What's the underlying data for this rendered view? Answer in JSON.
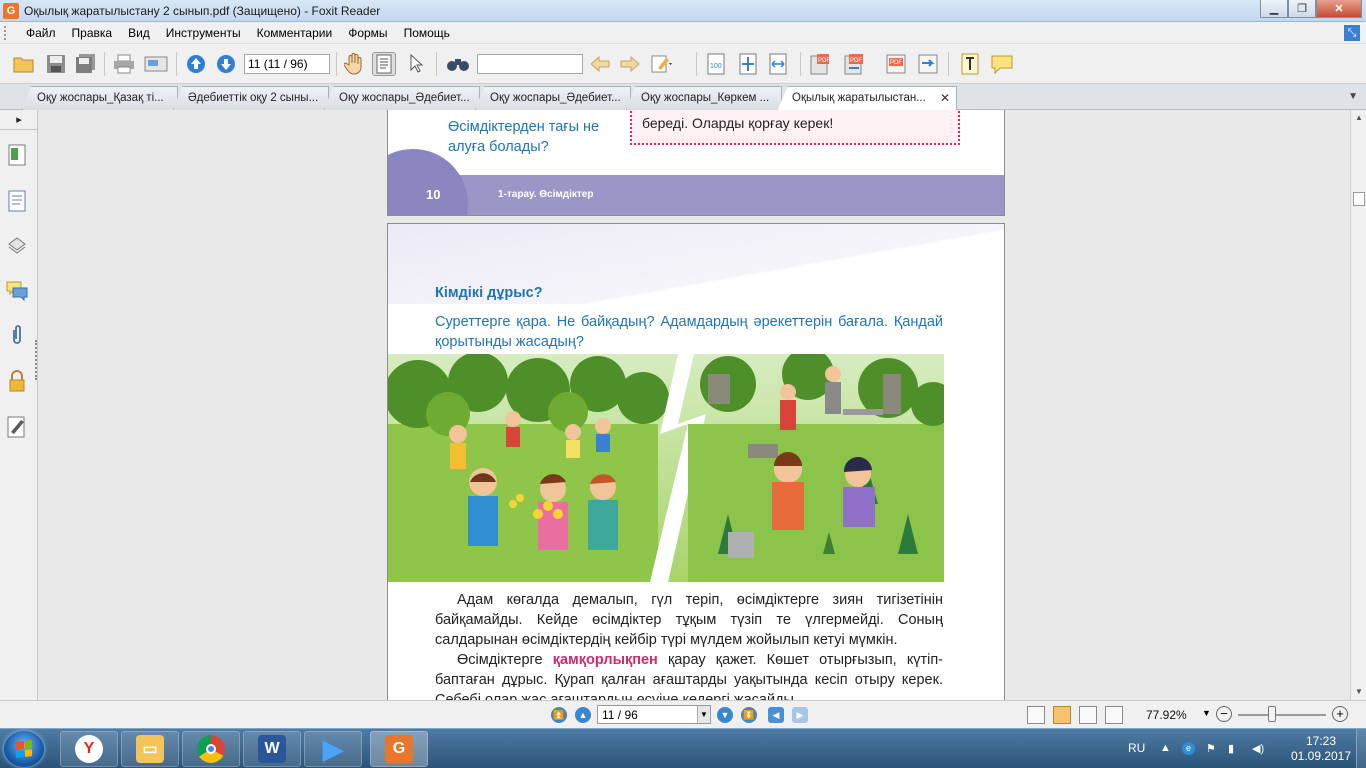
{
  "window": {
    "title": "Оқылық жаратылыстану 2 сынып.pdf (Защищено) - Foxit Reader",
    "app_icon": "foxit-logo-icon",
    "buttons": [
      "minimize-icon",
      "maximize-icon",
      "close-icon"
    ]
  },
  "menu": {
    "items": [
      "Файл",
      "Правка",
      "Вид",
      "Инструменты",
      "Комментарии",
      "Формы",
      "Помощь"
    ]
  },
  "toolbar": {
    "page_value": "11 (11 / 96)",
    "find_value": "",
    "icons": [
      "open-icon",
      "save-icon",
      "save-all-icon",
      "print-icon",
      "scan-icon",
      "prev-page-icon",
      "next-page-icon",
      "hand-tool-icon",
      "select-text-icon",
      "select-icon",
      "find-icon",
      "find-prev-icon",
      "find-next-icon",
      "highlight-icon",
      "zoom-actual-icon",
      "fit-page-icon",
      "fit-width-icon",
      "create-pdf-icon",
      "convert-icon",
      "pdf-icon",
      "export-icon",
      "typewriter-icon",
      "note-icon"
    ]
  },
  "tabs": [
    {
      "label": "Оқу жоспары_Қазақ ті..."
    },
    {
      "label": "Әдебиеттік оқу 2 сыны..."
    },
    {
      "label": "Оқу жоспары_Әдебиет..."
    },
    {
      "label": "Оқу жоспары_Әдебиет..."
    },
    {
      "label": "Оқу жоспары_Көркем ..."
    },
    {
      "label": "Оқылық жаратылыстан..."
    }
  ],
  "left_panel": {
    "collapse": "▸",
    "icons": [
      "bookmarks-icon",
      "pages-icon",
      "layers-icon",
      "comments-icon",
      "attachments-icon",
      "security-icon",
      "signatures-icon"
    ]
  },
  "page10": {
    "question_line1": "Өсімдіктерден тағы не",
    "question_line2": "алуға болады?",
    "note": "береді. Оларды қорғау керек!",
    "page_number": "10",
    "section": "1-тарау. Өсімдіктер"
  },
  "page11": {
    "heading": "Кімдікі дұрыс?",
    "instruction": "Суреттерге қара. Не байқадың? Адамдардың әрекеттерін бағала. Қандай қорытынды жасадың?",
    "para1": "Адам көгалда демалып, гүл теріп, өсімдіктерге зиян тигізетінін байқамайды. Кейде өсімдіктер тұқым түзіп те үлгермейді. Соның салдарынан өсімдіктердің кейбір түрі мүлдем жойылып кетуі мүмкін.",
    "para2_lead": "Өсімдіктерге ",
    "para2_highlight": "қамқорлықпен",
    "para2_rest": " қарау қажет. Көшет отырғызып, күтіп-баптаған дұрыс. Қурап қалған ағаштарды уақытында кесіп отыру керек. Себебі олар жас ағаштардың өсуіне кедергі жасайды."
  },
  "statusbar": {
    "page_value": "11 / 96",
    "zoom": "77.92%",
    "zoom_level": 0.39
  },
  "taskbar": {
    "apps": [
      "yandex-browser-icon",
      "file-explorer-icon",
      "chrome-icon",
      "word-icon",
      "media-player-icon",
      "foxit-reader-icon"
    ],
    "lang": "RU",
    "time": "17:23",
    "date": "01.09.2017"
  },
  "colors": {
    "accent_blue": "#1f74b8",
    "highlight_pink": "#d42a6a",
    "footer_purple": "#9b96c8"
  }
}
